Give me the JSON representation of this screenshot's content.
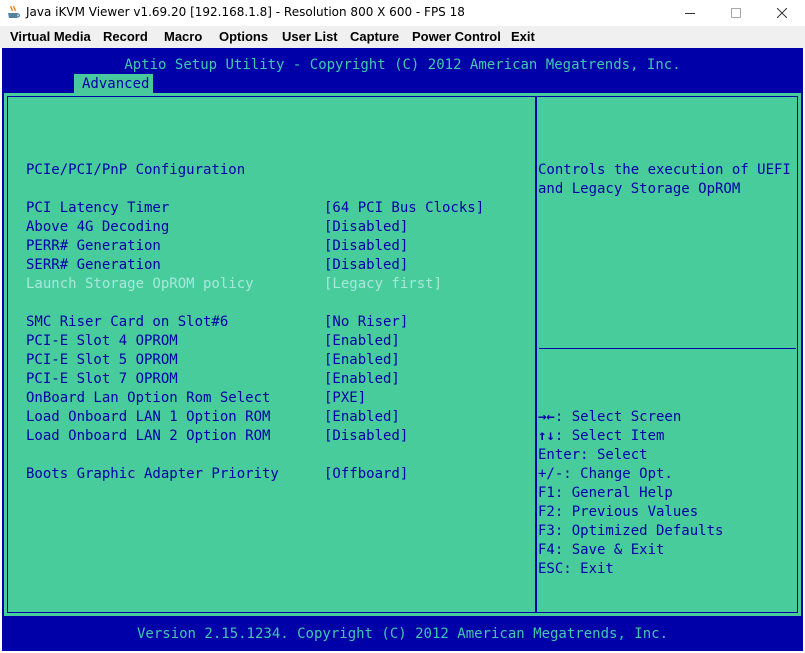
{
  "window": {
    "title": "Java iKVM Viewer v1.69.20 [192.168.1.8]  - Resolution 800 X 600 - FPS 18"
  },
  "menu": [
    "Virtual Media",
    "Record",
    "Macro",
    "Options",
    "User List",
    "Capture",
    "Power Control",
    "Exit"
  ],
  "bios": {
    "header": "Aptio Setup Utility - Copyright (C) 2012 American Megatrends, Inc.",
    "tab": "Advanced",
    "section_title": "PCIe/PCI/PnP Configuration",
    "settings": [
      {
        "label": "PCI Latency Timer",
        "value": "[64 PCI Bus Clocks]",
        "enabled": true
      },
      {
        "label": "Above 4G Decoding",
        "value": "[Disabled]",
        "enabled": true
      },
      {
        "label": "PERR# Generation",
        "value": "[Disabled]",
        "enabled": true
      },
      {
        "label": "SERR# Generation",
        "value": "[Disabled]",
        "enabled": true
      },
      {
        "label": "Launch Storage OpROM policy",
        "value": "[Legacy first]",
        "enabled": false
      },
      {
        "label": "SMC Riser Card on Slot#6",
        "value": "[No Riser]",
        "enabled": true
      },
      {
        "label": "PCI-E Slot 4 OPROM",
        "value": "[Enabled]",
        "enabled": true
      },
      {
        "label": "PCI-E Slot 5 OPROM",
        "value": "[Enabled]",
        "enabled": true
      },
      {
        "label": "PCI-E Slot 7 OPROM",
        "value": "[Enabled]",
        "enabled": true
      },
      {
        "label": "OnBoard Lan Option Rom Select",
        "value": "[PXE]",
        "enabled": true
      },
      {
        "label": "Load Onboard LAN 1 Option ROM",
        "value": "[Enabled]",
        "enabled": true
      },
      {
        "label": "Load Onboard LAN 2 Option ROM",
        "value": "[Disabled]",
        "enabled": true
      },
      {
        "label": "Boots Graphic Adapter Priority",
        "value": "[Offboard]",
        "enabled": true
      }
    ],
    "help_text": [
      "Controls the execution of UEFI",
      "and Legacy Storage OpROM"
    ],
    "key_help": [
      {
        "key": "→←",
        "desc": ": Select Screen"
      },
      {
        "key": "↑↓",
        "desc": ": Select Item"
      },
      {
        "key": "",
        "desc": "Enter: Select"
      },
      {
        "key": "",
        "desc": "+/-: Change Opt."
      },
      {
        "key": "",
        "desc": "F1: General Help"
      },
      {
        "key": "",
        "desc": "F2: Previous Values"
      },
      {
        "key": "",
        "desc": "F3: Optimized Defaults"
      },
      {
        "key": "",
        "desc": "F4: Save & Exit"
      },
      {
        "key": "",
        "desc": "ESC: Exit"
      }
    ],
    "footer": "Version 2.15.1234. Copyright (C) 2012 American Megatrends, Inc."
  },
  "colors": {
    "bios_blue": "#0000a8",
    "bios_green": "#48cc9c",
    "header_cyan": "#40c8b0",
    "disabled_text": "#a8e8dc"
  }
}
